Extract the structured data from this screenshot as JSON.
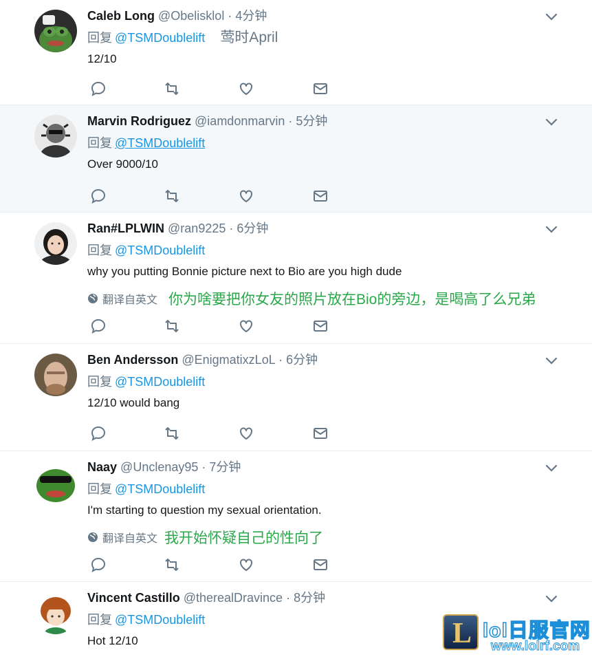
{
  "reply_label": "回复",
  "translate_label": "翻译自英文",
  "tweets": [
    {
      "name": "Caleb Long",
      "handle": "@Obelisklol",
      "dot": "·",
      "time": "4分钟",
      "mention": "@TSMDoublelift",
      "note": "莺时April",
      "text": "12/10",
      "translation": ""
    },
    {
      "name": "Marvin Rodriguez",
      "handle": "@iamdonmarvin",
      "dot": "·",
      "time": "5分钟",
      "mention": "@TSMDoublelift",
      "note": "",
      "text": "Over 9000/10",
      "translation": ""
    },
    {
      "name": "Ran#LPLWIN",
      "handle": "@ran9225",
      "dot": "·",
      "time": "6分钟",
      "mention": "@TSMDoublelift",
      "note": "",
      "text": "why you putting Bonnie picture next to Bio are you high dude",
      "translation": "你为啥要把你女友的照片放在Bio的旁边，是喝高了么兄弟"
    },
    {
      "name": "Ben Andersson",
      "handle": "@EnigmatixzLoL",
      "dot": "·",
      "time": "6分钟",
      "mention": "@TSMDoublelift",
      "note": "",
      "text": "12/10 would bang",
      "translation": ""
    },
    {
      "name": "Naay",
      "handle": "@Unclenay95",
      "dot": "·",
      "time": "7分钟",
      "mention": "@TSMDoublelift",
      "note": "",
      "text": "I'm starting to question my sexual orientation.",
      "translation": "我开始怀疑自己的性向了"
    },
    {
      "name": "Vincent Castillo",
      "handle": "@therealDravince",
      "dot": "·",
      "time": "8分钟",
      "mention": "@TSMDoublelift",
      "note": "",
      "text": "Hot 12/10",
      "translation": ""
    }
  ],
  "watermark": {
    "letter": "L",
    "title": "lol日服官网",
    "url": "www.lolrf.com"
  }
}
